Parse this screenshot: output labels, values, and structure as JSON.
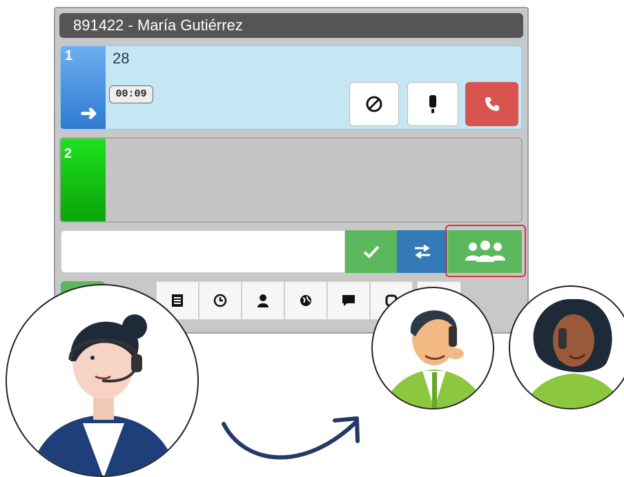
{
  "window": {
    "title": "891422 - María Gutiérrez"
  },
  "line1": {
    "number": "1",
    "dialed": "28",
    "timer": "00:09"
  },
  "line2": {
    "number": "2"
  },
  "dial_input": {
    "value": ""
  },
  "colors": {
    "line1_active": "#2d7ad0",
    "line2_free": "#0aa40a",
    "hangup": "#d9534f",
    "confirm": "#5cb85c",
    "transfer": "#337ab7",
    "highlight": "#d9303a"
  },
  "icons": {
    "line1_controls": [
      "block-icon",
      "mute-icon",
      "hangup-phone-icon"
    ],
    "dial_actions": [
      "check-icon",
      "transfer-arrows-icon",
      "conference-users-icon"
    ],
    "toolbar": [
      "notes-icon",
      "history-icon",
      "contact-icon",
      "web-icon",
      "chat-icon",
      "settings-icon"
    ]
  }
}
